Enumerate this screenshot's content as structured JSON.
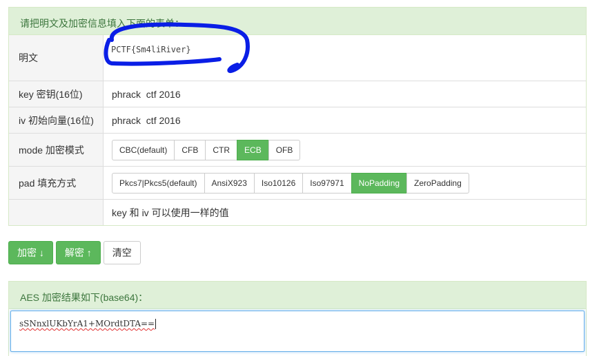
{
  "form": {
    "heading": "请把明文及加密信息填入下面的表单：",
    "plaintext": {
      "label": "明文",
      "value": "PCTF{Sm4liRiver}"
    },
    "key": {
      "label": "key 密钥(16位)",
      "value": "phrack  ctf 2016"
    },
    "iv": {
      "label": "iv 初始向量(16位)",
      "value": "phrack  ctf 2016"
    },
    "mode": {
      "label": "mode 加密模式",
      "options": [
        "CBC(default)",
        "CFB",
        "CTR",
        "ECB",
        "OFB"
      ],
      "selected": "ECB"
    },
    "pad": {
      "label": "pad 填充方式",
      "options": [
        "Pkcs7|Pkcs5(default)",
        "AnsiX923",
        "Iso10126",
        "Iso97971",
        "NoPadding",
        "ZeroPadding"
      ],
      "selected": "NoPadding"
    },
    "note": "key 和 iv 可以使用一样的值"
  },
  "actions": {
    "encrypt": "加密 ↓",
    "decrypt": "解密 ↑",
    "clear": "清空"
  },
  "result": {
    "heading": "AES 加密结果如下(base64)：",
    "value": "sSNnxlUKbYrA1+MOrdtDTA=="
  },
  "colors": {
    "accent": "#5cb85c",
    "heading_bg": "#dff0d8",
    "heading_text": "#3c763d",
    "annotation": "#0a1ee6"
  }
}
